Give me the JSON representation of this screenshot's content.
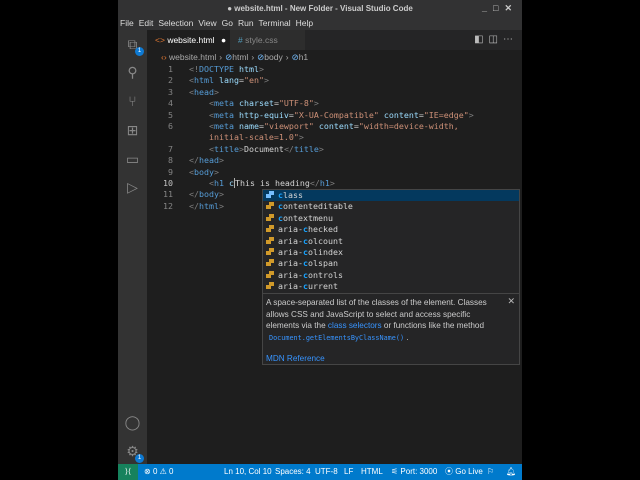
{
  "window": {
    "title": "● website.html - New Folder - Visual Studio Code",
    "controls": [
      "_",
      "□",
      "✕"
    ]
  },
  "menu": [
    "File",
    "Edit",
    "Selection",
    "View",
    "Go",
    "Run",
    "Terminal",
    "Help"
  ],
  "activity": {
    "explorer_badge": "1",
    "settings_badge": "1"
  },
  "tabs": [
    {
      "label": "website.html",
      "icon": "<>",
      "dirty": "●"
    },
    {
      "label": "style.css",
      "icon": "#"
    }
  ],
  "breadcrumb": [
    "website.html",
    "html",
    "body",
    "h1"
  ],
  "editor": {
    "line_numbers": [
      "1",
      "2",
      "3",
      "4",
      "5",
      "6",
      "",
      "7",
      "8",
      "9",
      "10",
      "11",
      "12"
    ]
  },
  "suggest": {
    "items": [
      "class",
      "contenteditable",
      "contextmenu",
      "aria-checked",
      "aria-colcount",
      "aria-colindex",
      "aria-colspan",
      "aria-controls",
      "aria-current"
    ],
    "doc_text_1": "A space-separated list of the classes of the element. Classes allows CSS and JavaScript to select and access specific elements via the ",
    "doc_link": "class selectors",
    "doc_text_2": " or functions like the method ",
    "doc_code": "Document.getElementsByClassName()",
    "doc_text_3": " .",
    "mdn": "MDN Reference",
    "close": "✕"
  },
  "status": {
    "remote": "⟩⟨",
    "errors": "0",
    "warnings": "0",
    "position": "Ln 10, Col 10",
    "spaces": "Spaces: 4",
    "encoding": "UTF-8",
    "eol": "LF",
    "language": "HTML",
    "port": "Port: 3000",
    "golive": "Go Live"
  },
  "colors": {
    "accent": "#007acc",
    "remote": "#16825d",
    "selection": "#04395e"
  }
}
